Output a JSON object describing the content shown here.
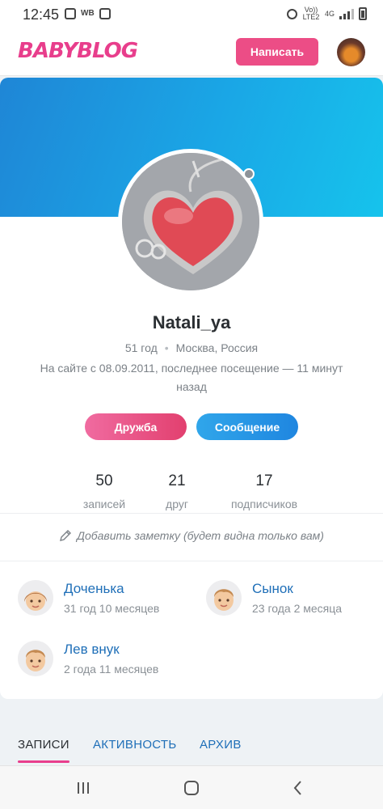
{
  "status_bar": {
    "time": "12:45",
    "wb": "WB",
    "network": "Vo)) LTE2",
    "network_type": "4G"
  },
  "header": {
    "logo": "BABYBLOG",
    "write_button": "Написать"
  },
  "profile": {
    "name": "Natali_ya",
    "age": "51 год",
    "location": "Москва, Россия",
    "since": "На сайте с 08.09.2011, последнее посещение — 11 минут назад",
    "friend_button": "Дружба",
    "message_button": "Сообщение",
    "accent_pink": "#e83e8c",
    "accent_blue": "#1f86e0"
  },
  "stats": [
    {
      "value": "50",
      "label": "записей"
    },
    {
      "value": "21",
      "label": "друг"
    },
    {
      "value": "17",
      "label": "подписчиков"
    }
  ],
  "note": "Добавить заметку (будет видна только вам)",
  "relatives": [
    {
      "name": "Доченька",
      "age": "31 год 10 месяцев",
      "icon": "girl-face-icon"
    },
    {
      "name": "Сынок",
      "age": "23 года 2 месяца",
      "icon": "boy-face-icon"
    },
    {
      "name": "Лев внук",
      "age": "2 года 11 месяцев",
      "icon": "boy-face-icon"
    }
  ],
  "tabs": [
    {
      "label": "ЗАПИСИ",
      "active": true
    },
    {
      "label": "АКТИВНОСТЬ",
      "active": false
    },
    {
      "label": "АРХИВ",
      "active": false
    }
  ],
  "nav": [
    "recents-icon",
    "home-icon",
    "back-icon"
  ]
}
